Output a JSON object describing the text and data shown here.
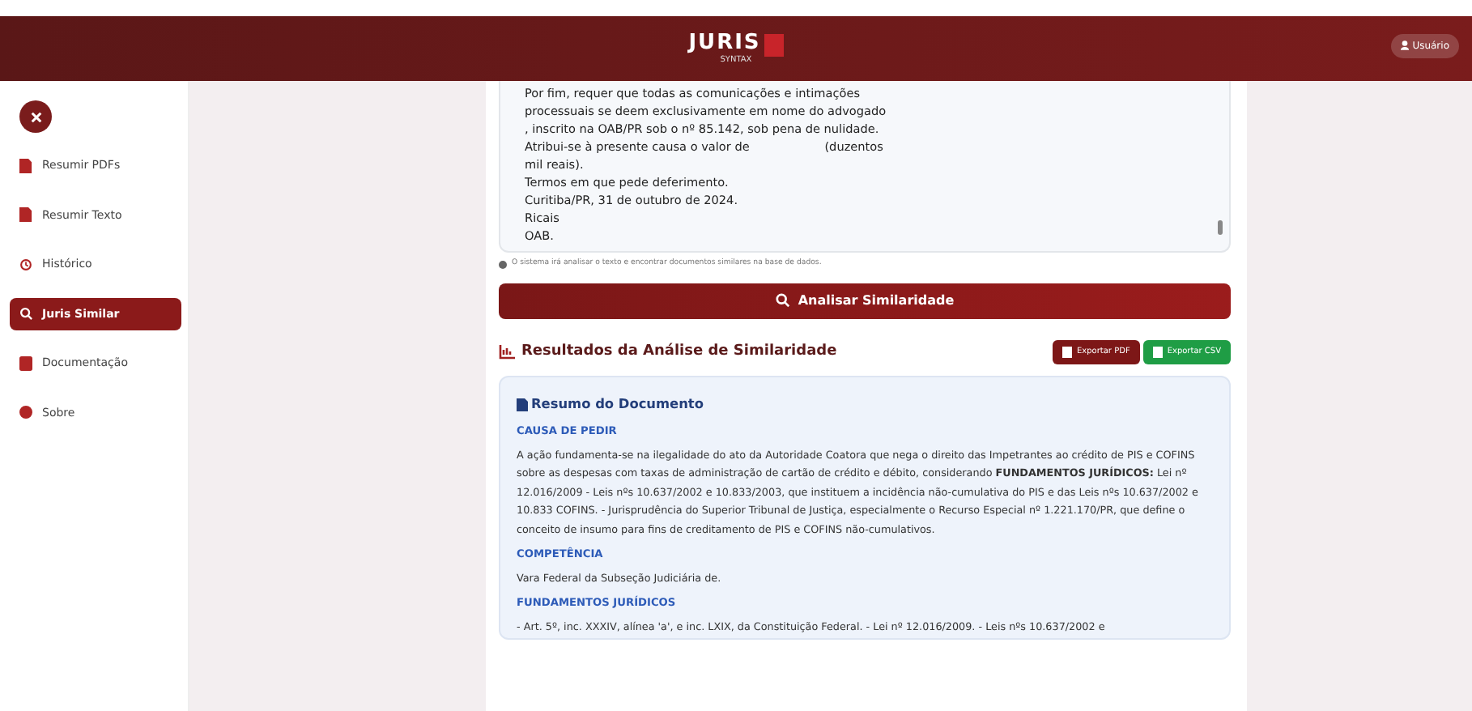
{
  "header": {
    "logo_word": "JURIS",
    "logo_sub": "SYNTAX",
    "user_button": "Usuário"
  },
  "sidebar": {
    "items": [
      {
        "label": "Resumir PDFs",
        "selected": false
      },
      {
        "label": "Resumir Texto",
        "selected": false
      },
      {
        "label": "Histórico",
        "selected": false
      },
      {
        "label": "Juris Similar",
        "selected": true
      },
      {
        "label": "Documentação",
        "selected": false
      },
      {
        "label": "Sobre",
        "selected": false
      }
    ]
  },
  "editor": {
    "lines": [
      "Por fim, requer que todas as comunicações e intimações",
      "processuais se deem exclusivamente em nome do advogado",
      ", inscrito na OAB/PR sob o nº 85.142, sob pena de nulidade.",
      "Atribui-se à presente causa o valor de                    (duzentos",
      "mil reais).",
      "Termos em que pede deferimento.",
      "Curitiba/PR, 31 de outubro de 2024.",
      "Ricais",
      "OAB."
    ],
    "hint": "O sistema irá analisar o texto e encontrar documentos similares na base de dados."
  },
  "analyze_button": "Analisar Similaridade",
  "results": {
    "title": "Resultados da Análise de Similaridade",
    "export_pdf": "Exportar PDF",
    "export_csv": "Exportar CSV",
    "summary": {
      "title": "Resumo do Documento",
      "sections": [
        {
          "heading": "CAUSA DE PEDIR",
          "text": "A ação fundamenta-se na ilegalidade do ato da Autoridade Coatora que nega o direito das Impetrantes ao crédito de PIS e COFINS sobre as despesas com taxas de administração de cartão de crédito e débito, considerando                                        **FUNDAMENTOS JURÍDICOS:**                                        Lei nº 12.016/2009 - Leis nºs 10.637/2002 e 10.833/2003, que instituem a incidência não-cumulativa do PIS e                     das Leis nºs 10.637/2002 e 10.833                                        COFINS. - Jurisprudência do Superior Tribunal de Justiça, especialmente o Recurso Especial nº 1.221.170/PR, que define o conceito de insumo para fins de creditamento de PIS e COFINS não-cumulativos."
        },
        {
          "heading": "COMPETÊNCIA",
          "text": "Vara Federal da Subseção Judiciária de."
        },
        {
          "heading": "FUNDAMENTOS JURÍDICOS",
          "text": "- Art. 5º, inc. XXXIV, alínea 'a', e inc. LXIX, da Constituição Federal. - Lei nº 12.016/2009. - Leis nºs 10.637/2002 e"
        }
      ]
    }
  }
}
